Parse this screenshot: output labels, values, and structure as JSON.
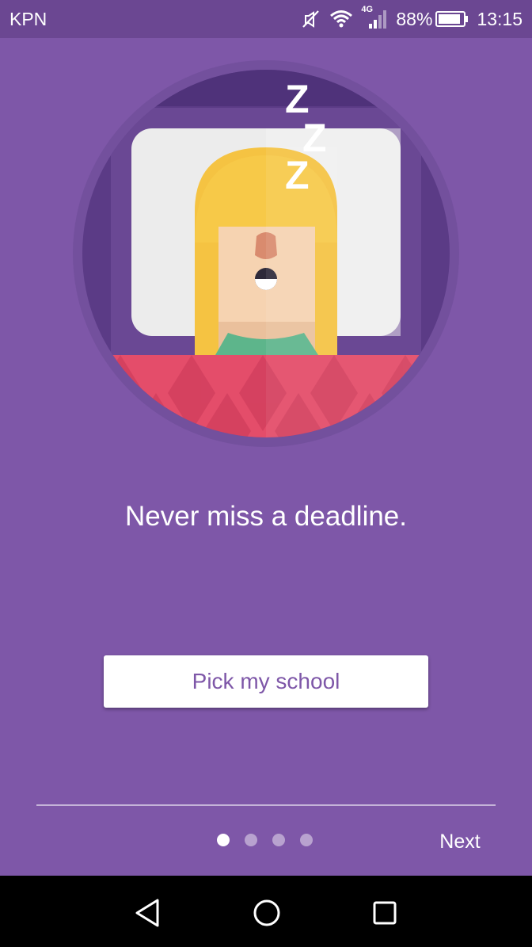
{
  "status_bar": {
    "carrier": "KPN",
    "network_type": "4G",
    "battery_percent": "88%",
    "time": "13:15",
    "icons": [
      "mute-icon",
      "wifi-icon",
      "signal-icon",
      "battery-icon"
    ]
  },
  "onboarding": {
    "illustration": "sleeping-person-illustration",
    "zzz": [
      "Z",
      "Z",
      "Z"
    ],
    "headline": "Never miss a deadline.",
    "pick_school_label": "Pick my school",
    "next_label": "Next",
    "pager": {
      "total": 4,
      "active_index": 0
    }
  },
  "nav_bar": {
    "icons": [
      "back-icon",
      "home-icon",
      "recents-icon"
    ]
  },
  "colors": {
    "background": "#7E57A8",
    "status_bar": "#6B4792",
    "button_text": "#7E57A8",
    "hair": "#F5C342",
    "blanket": "#E44D6A"
  }
}
